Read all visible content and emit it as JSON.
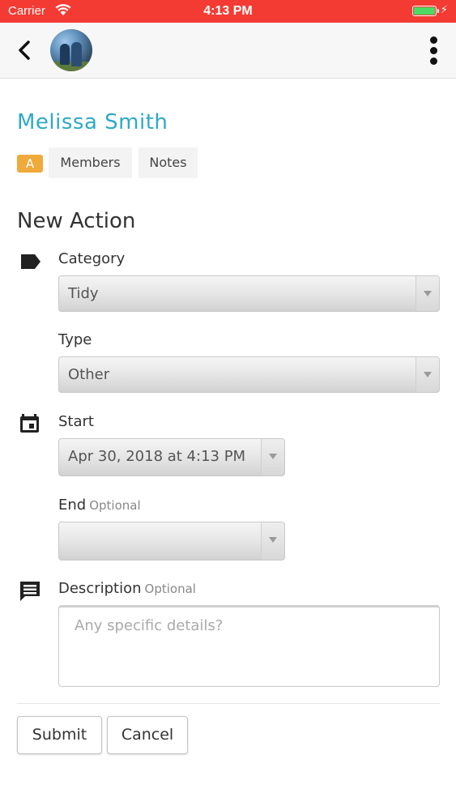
{
  "status_bar": {
    "carrier": "Carrier",
    "time": "4:13 PM",
    "bar_color": "#f33b34",
    "battery_color": "#4cd964",
    "icons": [
      "wifi-icon",
      "battery-icon",
      "charging-bolt-icon"
    ]
  },
  "nav": {
    "icons": [
      "back-chevron-icon",
      "avatar",
      "more-vertical-icon"
    ]
  },
  "profile": {
    "name": "Melissa Smith",
    "name_color": "#2ea9c9",
    "badge": "A",
    "badge_color": "#f0a93b",
    "tabs": [
      {
        "label": "Members"
      },
      {
        "label": "Notes"
      }
    ]
  },
  "form": {
    "title": "New Action",
    "category": {
      "label": "Category",
      "value": "Tidy",
      "icon": "tag-icon"
    },
    "type": {
      "label": "Type",
      "value": "Other"
    },
    "start": {
      "label": "Start",
      "value": "Apr 30, 2018 at 4:13 PM",
      "icon": "calendar-icon"
    },
    "end": {
      "label": "End",
      "optional": "Optional",
      "value": ""
    },
    "description": {
      "label": "Description",
      "optional": "Optional",
      "placeholder": "Any specific details?",
      "icon": "comment-icon"
    },
    "submit_label": "Submit",
    "cancel_label": "Cancel"
  }
}
